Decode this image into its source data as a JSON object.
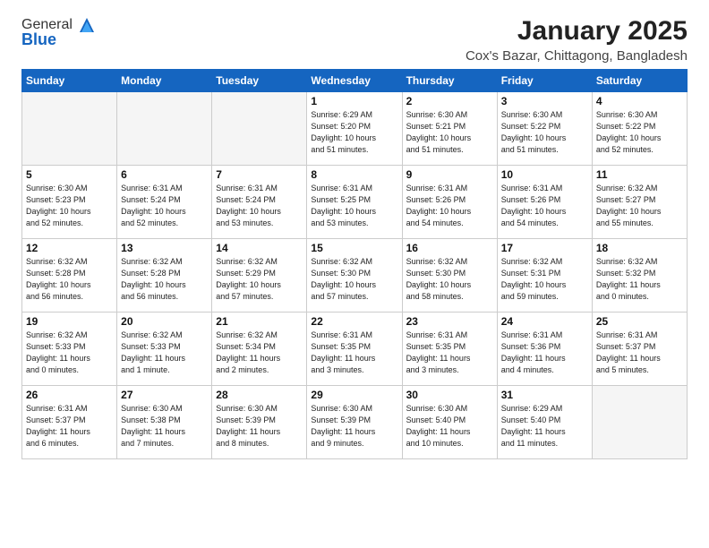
{
  "logo": {
    "line1": "General",
    "line2": "Blue"
  },
  "title": "January 2025",
  "subtitle": "Cox's Bazar, Chittagong, Bangladesh",
  "days": [
    "Sunday",
    "Monday",
    "Tuesday",
    "Wednesday",
    "Thursday",
    "Friday",
    "Saturday"
  ],
  "weeks": [
    [
      {
        "num": "",
        "info": ""
      },
      {
        "num": "",
        "info": ""
      },
      {
        "num": "",
        "info": ""
      },
      {
        "num": "1",
        "info": "Sunrise: 6:29 AM\nSunset: 5:20 PM\nDaylight: 10 hours\nand 51 minutes."
      },
      {
        "num": "2",
        "info": "Sunrise: 6:30 AM\nSunset: 5:21 PM\nDaylight: 10 hours\nand 51 minutes."
      },
      {
        "num": "3",
        "info": "Sunrise: 6:30 AM\nSunset: 5:22 PM\nDaylight: 10 hours\nand 51 minutes."
      },
      {
        "num": "4",
        "info": "Sunrise: 6:30 AM\nSunset: 5:22 PM\nDaylight: 10 hours\nand 52 minutes."
      }
    ],
    [
      {
        "num": "5",
        "info": "Sunrise: 6:30 AM\nSunset: 5:23 PM\nDaylight: 10 hours\nand 52 minutes."
      },
      {
        "num": "6",
        "info": "Sunrise: 6:31 AM\nSunset: 5:24 PM\nDaylight: 10 hours\nand 52 minutes."
      },
      {
        "num": "7",
        "info": "Sunrise: 6:31 AM\nSunset: 5:24 PM\nDaylight: 10 hours\nand 53 minutes."
      },
      {
        "num": "8",
        "info": "Sunrise: 6:31 AM\nSunset: 5:25 PM\nDaylight: 10 hours\nand 53 minutes."
      },
      {
        "num": "9",
        "info": "Sunrise: 6:31 AM\nSunset: 5:26 PM\nDaylight: 10 hours\nand 54 minutes."
      },
      {
        "num": "10",
        "info": "Sunrise: 6:31 AM\nSunset: 5:26 PM\nDaylight: 10 hours\nand 54 minutes."
      },
      {
        "num": "11",
        "info": "Sunrise: 6:32 AM\nSunset: 5:27 PM\nDaylight: 10 hours\nand 55 minutes."
      }
    ],
    [
      {
        "num": "12",
        "info": "Sunrise: 6:32 AM\nSunset: 5:28 PM\nDaylight: 10 hours\nand 56 minutes."
      },
      {
        "num": "13",
        "info": "Sunrise: 6:32 AM\nSunset: 5:28 PM\nDaylight: 10 hours\nand 56 minutes."
      },
      {
        "num": "14",
        "info": "Sunrise: 6:32 AM\nSunset: 5:29 PM\nDaylight: 10 hours\nand 57 minutes."
      },
      {
        "num": "15",
        "info": "Sunrise: 6:32 AM\nSunset: 5:30 PM\nDaylight: 10 hours\nand 57 minutes."
      },
      {
        "num": "16",
        "info": "Sunrise: 6:32 AM\nSunset: 5:30 PM\nDaylight: 10 hours\nand 58 minutes."
      },
      {
        "num": "17",
        "info": "Sunrise: 6:32 AM\nSunset: 5:31 PM\nDaylight: 10 hours\nand 59 minutes."
      },
      {
        "num": "18",
        "info": "Sunrise: 6:32 AM\nSunset: 5:32 PM\nDaylight: 11 hours\nand 0 minutes."
      }
    ],
    [
      {
        "num": "19",
        "info": "Sunrise: 6:32 AM\nSunset: 5:33 PM\nDaylight: 11 hours\nand 0 minutes."
      },
      {
        "num": "20",
        "info": "Sunrise: 6:32 AM\nSunset: 5:33 PM\nDaylight: 11 hours\nand 1 minute."
      },
      {
        "num": "21",
        "info": "Sunrise: 6:32 AM\nSunset: 5:34 PM\nDaylight: 11 hours\nand 2 minutes."
      },
      {
        "num": "22",
        "info": "Sunrise: 6:31 AM\nSunset: 5:35 PM\nDaylight: 11 hours\nand 3 minutes."
      },
      {
        "num": "23",
        "info": "Sunrise: 6:31 AM\nSunset: 5:35 PM\nDaylight: 11 hours\nand 3 minutes."
      },
      {
        "num": "24",
        "info": "Sunrise: 6:31 AM\nSunset: 5:36 PM\nDaylight: 11 hours\nand 4 minutes."
      },
      {
        "num": "25",
        "info": "Sunrise: 6:31 AM\nSunset: 5:37 PM\nDaylight: 11 hours\nand 5 minutes."
      }
    ],
    [
      {
        "num": "26",
        "info": "Sunrise: 6:31 AM\nSunset: 5:37 PM\nDaylight: 11 hours\nand 6 minutes."
      },
      {
        "num": "27",
        "info": "Sunrise: 6:30 AM\nSunset: 5:38 PM\nDaylight: 11 hours\nand 7 minutes."
      },
      {
        "num": "28",
        "info": "Sunrise: 6:30 AM\nSunset: 5:39 PM\nDaylight: 11 hours\nand 8 minutes."
      },
      {
        "num": "29",
        "info": "Sunrise: 6:30 AM\nSunset: 5:39 PM\nDaylight: 11 hours\nand 9 minutes."
      },
      {
        "num": "30",
        "info": "Sunrise: 6:30 AM\nSunset: 5:40 PM\nDaylight: 11 hours\nand 10 minutes."
      },
      {
        "num": "31",
        "info": "Sunrise: 6:29 AM\nSunset: 5:40 PM\nDaylight: 11 hours\nand 11 minutes."
      },
      {
        "num": "",
        "info": ""
      }
    ]
  ]
}
